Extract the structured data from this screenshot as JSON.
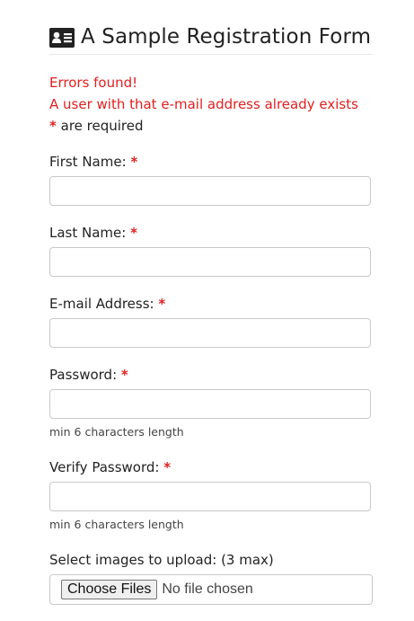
{
  "form": {
    "title": "A Sample Registration Form",
    "title_icon": "id-card-icon"
  },
  "errors": {
    "heading": "Errors found!",
    "message": "A user with that e-mail address already exists"
  },
  "required_note": {
    "marker": "*",
    "text": " are required"
  },
  "fields": {
    "first_name": {
      "label": "First Name:",
      "required_marker": "*",
      "value": ""
    },
    "last_name": {
      "label": "Last Name:",
      "required_marker": "*",
      "value": ""
    },
    "email": {
      "label": "E-mail Address:",
      "required_marker": "*",
      "value": ""
    },
    "password": {
      "label": "Password:",
      "required_marker": "*",
      "value": "",
      "hint": "min 6 characters length"
    },
    "verify_password": {
      "label": "Verify Password:",
      "required_marker": "*",
      "value": "",
      "hint": "min 6 characters length"
    }
  },
  "upload": {
    "label": "Select images to upload: (3 max)",
    "button_label": "Choose Files",
    "status": "No file chosen"
  },
  "colors": {
    "error": "#e02020",
    "text": "#222222",
    "border": "#c8c8c8"
  }
}
